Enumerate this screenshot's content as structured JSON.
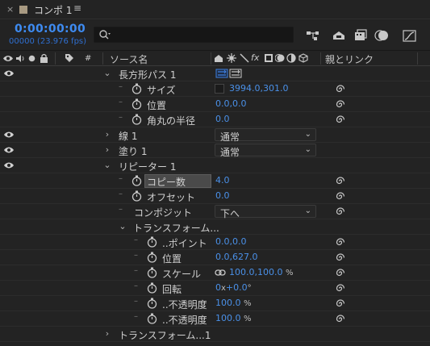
{
  "tab": {
    "close": "×",
    "title": "コンポ 1",
    "menu": "≡"
  },
  "header": {
    "timecode": "0:00:00:00",
    "frames": "00000 (23.976 fps)",
    "search_placeholder": ""
  },
  "columns": {
    "source_name": "ソース名",
    "parent": "親とリンク",
    "hash": "#",
    "fx": "fx"
  },
  "rows": [
    {
      "name": "長方形パス 1",
      "caret": "⌄",
      "eye": true
    },
    {
      "name": "サイズ",
      "value": "3994.0,301.0",
      "pickwhip": true
    },
    {
      "name": "位置",
      "value": "0.0,0.0",
      "pickwhip": true
    },
    {
      "name": "角丸の半径",
      "value": "0.0",
      "pickwhip": true
    },
    {
      "name": "線 1",
      "caret": "›",
      "eye": true,
      "select": "通常"
    },
    {
      "name": "塗り 1",
      "caret": "›",
      "eye": true,
      "select": "通常"
    },
    {
      "name": "リピーター 1",
      "caret": "⌄",
      "eye": true
    },
    {
      "name": "コピー数",
      "value": "4.0",
      "pickwhip": true
    },
    {
      "name": "オフセット",
      "value": "0.0",
      "pickwhip": true
    },
    {
      "name": "コンポジット",
      "select": "下へ"
    },
    {
      "name": "トランスフォーム...",
      "caret": "⌄"
    },
    {
      "name": "..ポイント",
      "value": "0.0,0.0",
      "pickwhip": true
    },
    {
      "name": "位置",
      "value": "0.0,627.0",
      "pickwhip": true
    },
    {
      "name": "スケール",
      "value": "100.0,100.0",
      "unit": "%",
      "pickwhip": true
    },
    {
      "name": "回転",
      "value": "0",
      "value2": "+0.0",
      "unit2": "°",
      "pickwhip": true
    },
    {
      "name": "..不透明度",
      "value": "100.0",
      "unit": "%",
      "pickwhip": true
    },
    {
      "name": "..不透明度",
      "value": "100.0",
      "unit": "%",
      "pickwhip": true
    },
    {
      "name": "トランスフォーム...1",
      "caret": "›"
    }
  ],
  "colors": {
    "accent": "#3e8bf1",
    "value_blue": "#4a90e8",
    "background": "#232323",
    "path_icon": "#3d7fe0"
  }
}
